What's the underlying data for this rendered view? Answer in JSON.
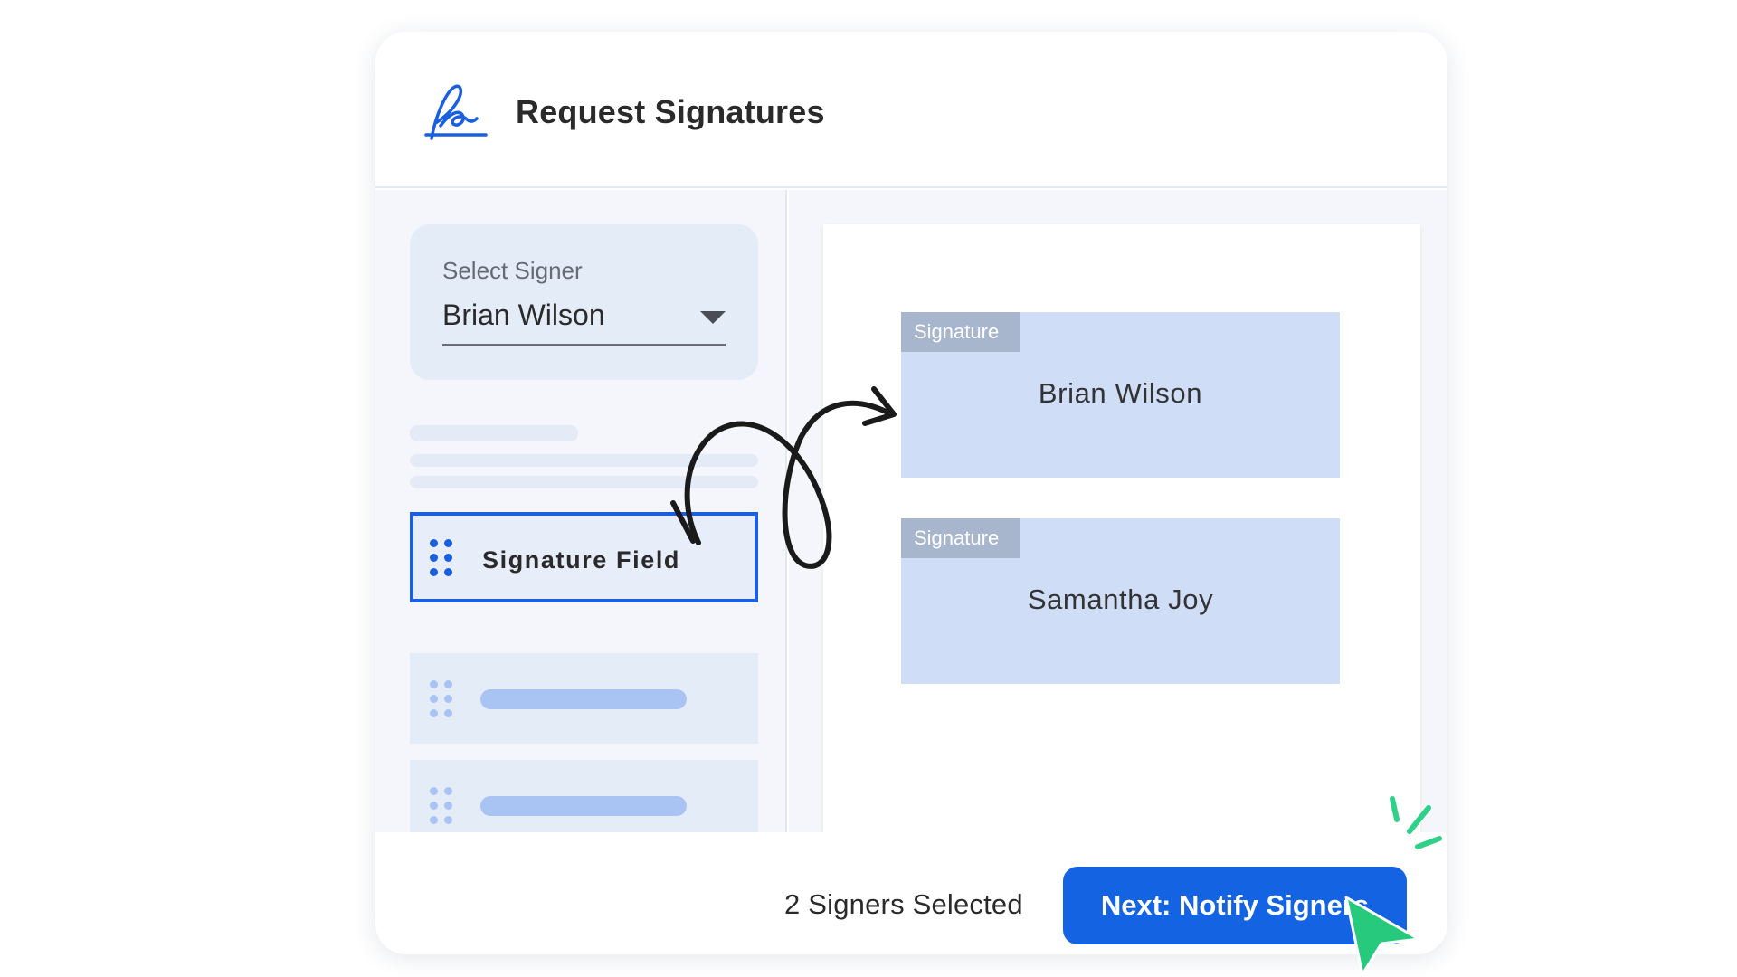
{
  "header": {
    "title": "Request Signatures",
    "logo_icon": "signature-pen-icon"
  },
  "signer_select": {
    "label": "Select Signer",
    "selected": "Brian Wilson"
  },
  "fields": [
    {
      "label": "Signature Field",
      "active": true
    }
  ],
  "document": {
    "signature_blocks": [
      {
        "tag": "Signature",
        "name": "Brian Wilson"
      },
      {
        "tag": "Signature",
        "name": "Samantha Joy"
      }
    ]
  },
  "footer": {
    "status": "2 Signers Selected",
    "next_button": "Next: Notify Signers"
  },
  "colors": {
    "primary": "#1463e3",
    "field_border": "#1a5fe0",
    "signature_block": "#cfddf7",
    "signature_tag": "#a7b6cc",
    "cursor": "#27c97d",
    "panel_bg": "#f4f6fb"
  }
}
